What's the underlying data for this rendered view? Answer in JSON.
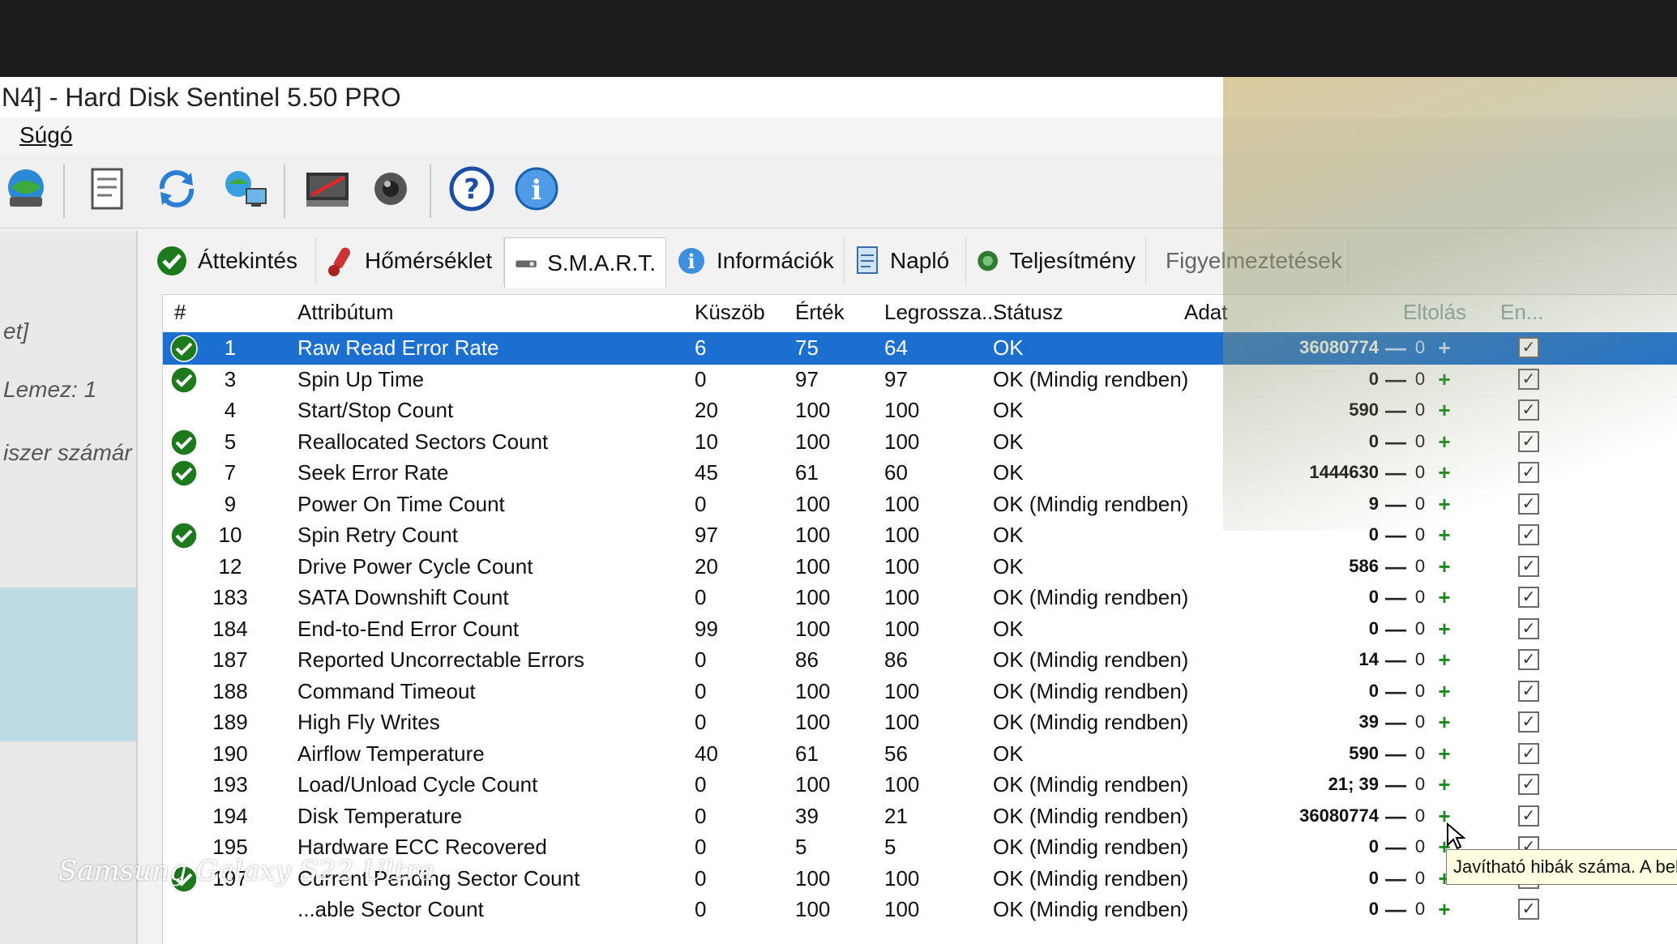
{
  "window": {
    "title": "N4]  -  Hard Disk Sentinel 5.50 PRO"
  },
  "menu": {
    "items": [
      "Súgó"
    ]
  },
  "toolbar": {
    "icons": [
      "disk-globe-icon",
      "report-icon",
      "refresh-icon",
      "network-icon",
      "disk-test-icon",
      "speaker-icon",
      "help-icon",
      "info-icon"
    ]
  },
  "sidebar": {
    "text1": "et]",
    "text2": "Lemez: 1",
    "text3": "iszer számár"
  },
  "tabs": [
    {
      "label": "Áttekintés",
      "icon": "check-icon",
      "active": false
    },
    {
      "label": "Hőmérséklet",
      "icon": "thermometer-icon",
      "active": false
    },
    {
      "label": "S.M.A.R.T.",
      "icon": "smart-icon",
      "active": true
    },
    {
      "label": "Információk",
      "icon": "info-icon",
      "active": false
    },
    {
      "label": "Napló",
      "icon": "log-icon",
      "active": false
    },
    {
      "label": "Teljesítmény",
      "icon": "performance-icon",
      "active": false
    },
    {
      "label": "Figyelmeztetések",
      "icon": "warning-icon",
      "active": false
    }
  ],
  "table": {
    "headers": {
      "num": "#",
      "attribute": "Attribútum",
      "threshold": "Küszöb",
      "value": "Érték",
      "worst": "Legrossza...",
      "status": "Státusz",
      "data": "Adat",
      "offset": "Eltolás",
      "enabled": "En..."
    },
    "rows": [
      {
        "check": true,
        "num": "1",
        "attr": "Raw Read Error Rate",
        "thr": "6",
        "val": "75",
        "worst": "64",
        "status": "OK",
        "data": "36080774",
        "offset": "0",
        "enabled": true,
        "selected": true
      },
      {
        "check": true,
        "num": "3",
        "attr": "Spin Up Time",
        "thr": "0",
        "val": "97",
        "worst": "97",
        "status": "OK (Mindig rendben)",
        "data": "0",
        "offset": "0",
        "enabled": true
      },
      {
        "check": false,
        "num": "4",
        "attr": "Start/Stop Count",
        "thr": "20",
        "val": "100",
        "worst": "100",
        "status": "OK",
        "data": "590",
        "offset": "0",
        "enabled": true
      },
      {
        "check": true,
        "num": "5",
        "attr": "Reallocated Sectors Count",
        "thr": "10",
        "val": "100",
        "worst": "100",
        "status": "OK",
        "data": "0",
        "offset": "0",
        "enabled": true
      },
      {
        "check": true,
        "num": "7",
        "attr": "Seek Error Rate",
        "thr": "45",
        "val": "61",
        "worst": "60",
        "status": "OK",
        "data": "1444630",
        "offset": "0",
        "enabled": true
      },
      {
        "check": false,
        "num": "9",
        "attr": "Power On Time Count",
        "thr": "0",
        "val": "100",
        "worst": "100",
        "status": "OK (Mindig rendben)",
        "data": "9",
        "offset": "0",
        "enabled": true
      },
      {
        "check": true,
        "num": "10",
        "attr": "Spin Retry Count",
        "thr": "97",
        "val": "100",
        "worst": "100",
        "status": "OK",
        "data": "0",
        "offset": "0",
        "enabled": true
      },
      {
        "check": false,
        "num": "12",
        "attr": "Drive Power Cycle Count",
        "thr": "20",
        "val": "100",
        "worst": "100",
        "status": "OK",
        "data": "586",
        "offset": "0",
        "enabled": true
      },
      {
        "check": false,
        "num": "183",
        "attr": "SATA Downshift Count",
        "thr": "0",
        "val": "100",
        "worst": "100",
        "status": "OK (Mindig rendben)",
        "data": "0",
        "offset": "0",
        "enabled": true
      },
      {
        "check": false,
        "num": "184",
        "attr": "End-to-End Error Count",
        "thr": "99",
        "val": "100",
        "worst": "100",
        "status": "OK",
        "data": "0",
        "offset": "0",
        "enabled": true
      },
      {
        "check": false,
        "num": "187",
        "attr": "Reported Uncorrectable Errors",
        "thr": "0",
        "val": "86",
        "worst": "86",
        "status": "OK (Mindig rendben)",
        "data": "14",
        "offset": "0",
        "enabled": true
      },
      {
        "check": false,
        "num": "188",
        "attr": "Command Timeout",
        "thr": "0",
        "val": "100",
        "worst": "100",
        "status": "OK (Mindig rendben)",
        "data": "0",
        "offset": "0",
        "enabled": true
      },
      {
        "check": false,
        "num": "189",
        "attr": "High Fly Writes",
        "thr": "0",
        "val": "100",
        "worst": "100",
        "status": "OK (Mindig rendben)",
        "data": "39",
        "offset": "0",
        "enabled": true
      },
      {
        "check": false,
        "num": "190",
        "attr": "Airflow Temperature",
        "thr": "40",
        "val": "61",
        "worst": "56",
        "status": "OK",
        "data": "590",
        "offset": "0",
        "enabled": true
      },
      {
        "check": false,
        "num": "193",
        "attr": "Load/Unload Cycle Count",
        "thr": "0",
        "val": "100",
        "worst": "100",
        "status": "OK (Mindig rendben)",
        "data": "21; 39",
        "offset": "0",
        "enabled": true
      },
      {
        "check": false,
        "num": "194",
        "attr": "Disk Temperature",
        "thr": "0",
        "val": "39",
        "worst": "21",
        "status": "OK (Mindig rendben)",
        "data": "36080774",
        "offset": "0",
        "enabled": true
      },
      {
        "check": false,
        "num": "195",
        "attr": "Hardware ECC Recovered",
        "thr": "0",
        "val": "5",
        "worst": "5",
        "status": "OK (Mindig rendben)",
        "data": "0",
        "offset": "0",
        "enabled": true
      },
      {
        "check": true,
        "num": "197",
        "attr": "Current Pending Sector Count",
        "thr": "0",
        "val": "100",
        "worst": "100",
        "status": "OK (Mindig rendben)",
        "data": "0",
        "offset": "0",
        "enabled": true
      },
      {
        "check": false,
        "num": "",
        "attr": "...able Sector Count",
        "thr": "0",
        "val": "100",
        "worst": "100",
        "status": "OK (Mindig rendben)",
        "data": "0",
        "offset": "0",
        "enabled": true
      }
    ]
  },
  "tooltip": {
    "text": "Javítható hibák száma. A belső"
  },
  "watermark": {
    "text": "Samsung Galaxy S22 Ultra"
  },
  "colors": {
    "selection": "#1a6fd0",
    "ok_green": "#1c8a1c"
  }
}
